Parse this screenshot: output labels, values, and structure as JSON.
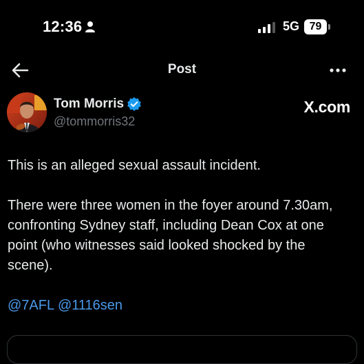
{
  "status_bar": {
    "time": "12:36",
    "network": "5G",
    "battery": "79"
  },
  "header": {
    "title": "Post"
  },
  "author": {
    "name": "Tom Morris",
    "handle": "@tommorris32",
    "verified": true
  },
  "source": {
    "label": "X.com"
  },
  "post": {
    "paragraphs": [
      "This is an alleged sexual assault incident.",
      "There were three women in the foyer around 7.30am, confronting Sydney staff, including Dean Cox at one point (who witnesses said looked shocked by the scene)."
    ],
    "mentions": [
      "@7AFL",
      "@1116sen"
    ]
  },
  "icons": {
    "back": "arrow-left-icon",
    "more": "more-dots-icon",
    "verified": "verified-badge-icon",
    "person": "person-icon",
    "signal": "signal-icon",
    "battery": "battery-icon"
  },
  "colors": {
    "background": "#000000",
    "text": "#e7e9ea",
    "secondary_text": "#71767b",
    "link": "#4a99e9",
    "verified": "#1d9bf0"
  }
}
